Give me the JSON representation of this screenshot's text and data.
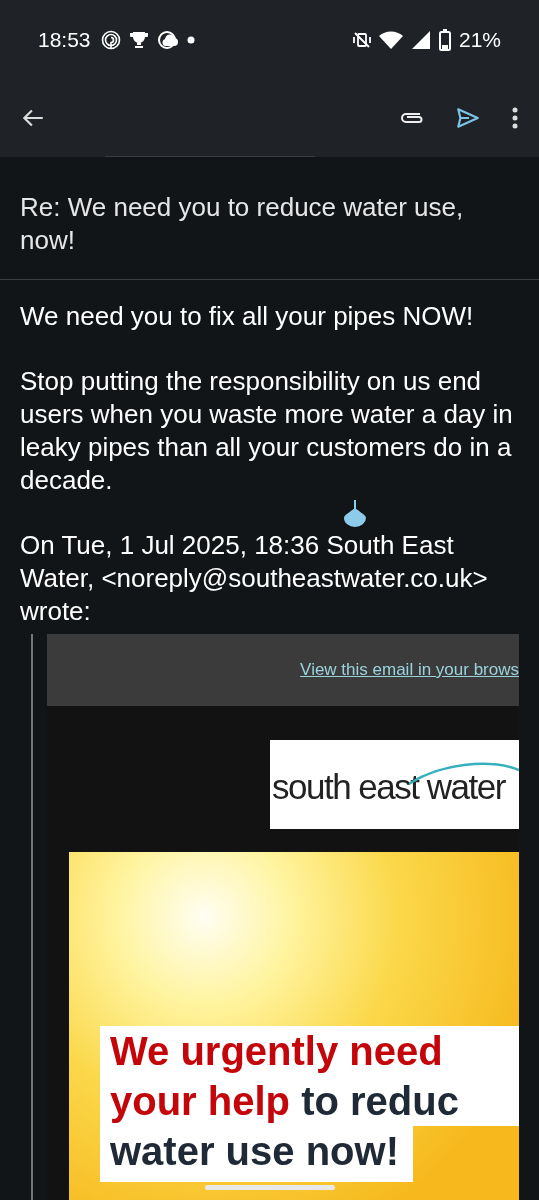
{
  "status_bar": {
    "time": "18:53",
    "battery": "21%"
  },
  "subject": "Re: We need you to reduce water use, now!",
  "body": [
    "We need you to fix all your pipes NOW!",
    "Stop putting the responsibility on us end users when you waste more water a day in leaky pipes than all your customers do in a decade."
  ],
  "quote_header": "On Tue, 1 Jul 2025, 18:36 South East Water, <noreply@southeastwater.co.uk> wrote:",
  "quoted": {
    "link": "View this email in your brows",
    "logo_text": "south east water",
    "banner": [
      [
        {
          "text": "We urgently need",
          "highlight": true
        }
      ],
      [
        {
          "text": "your help",
          "highlight": true
        },
        {
          "text": " to reduc",
          "highlight": false
        }
      ],
      [
        {
          "text": "water use now!",
          "highlight": false
        }
      ]
    ]
  }
}
